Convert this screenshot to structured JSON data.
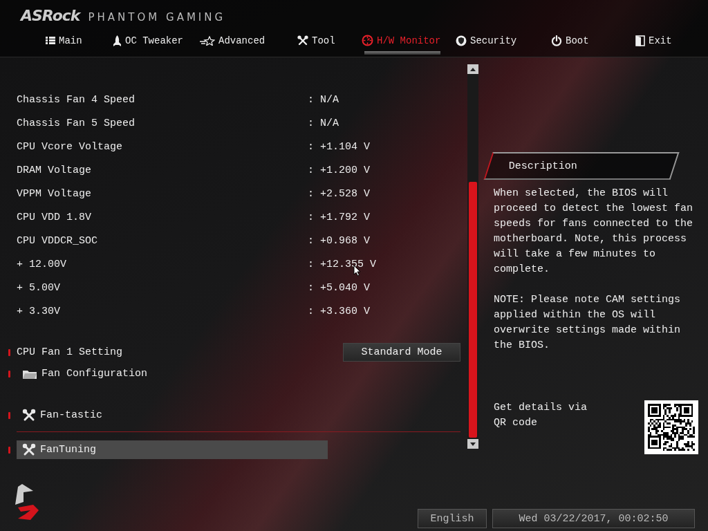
{
  "brand": {
    "logo": "ASRock",
    "subtitle": "PHANTOM GAMING"
  },
  "tabs": [
    {
      "kind": "main",
      "label": "Main",
      "selected": false
    },
    {
      "kind": "oc",
      "label": "OC Tweaker",
      "selected": false
    },
    {
      "kind": "advanced",
      "label": "Advanced",
      "selected": false
    },
    {
      "kind": "tool",
      "label": "Tool",
      "selected": false
    },
    {
      "kind": "monitor",
      "label": "H/W Monitor",
      "selected": true
    },
    {
      "kind": "security",
      "label": "Security",
      "selected": false
    },
    {
      "kind": "boot",
      "label": "Boot",
      "selected": false
    },
    {
      "kind": "exit",
      "label": "Exit",
      "selected": false
    }
  ],
  "readings": [
    {
      "label": "Chassis Fan 4 Speed",
      "value": ": N/A"
    },
    {
      "label": "Chassis Fan 5 Speed",
      "value": ": N/A"
    },
    {
      "label": "CPU Vcore Voltage",
      "value": ": +1.104 V"
    },
    {
      "label": "DRAM Voltage",
      "value": ": +1.200 V"
    },
    {
      "label": "VPPM Voltage",
      "value": ": +2.528 V"
    },
    {
      "label": "CPU VDD 1.8V",
      "value": ": +1.792 V"
    },
    {
      "label": "CPU VDDCR_SOC",
      "value": ": +0.968 V"
    },
    {
      "label": "+ 12.00V",
      "value": ": +12.355 V"
    },
    {
      "label": "+ 5.00V",
      "value": ": +5.040 V"
    },
    {
      "label": "+ 3.30V",
      "value": ": +3.360 V"
    }
  ],
  "menu": [
    {
      "kind": "setting",
      "label": "CPU Fan 1 Setting",
      "value": "Standard Mode",
      "selected": false
    },
    {
      "kind": "folder",
      "label": "Fan Configuration",
      "selected": false
    },
    {
      "kind": "tool",
      "label": "Fan-tastic",
      "selected": false
    },
    {
      "kind": "tool",
      "label": "FanTuning",
      "selected": true
    }
  ],
  "description": {
    "title": "Description",
    "paragraphs": [
      "When selected, the BIOS will proceed to detect the lowest fan speeds for fans connected to the motherboard. Note, this process will take a few minutes to complete.",
      "NOTE: Please note CAM settings applied within the OS will overwrite settings made within the BIOS."
    ],
    "qr_caption": "Get details via QR code"
  },
  "footer": {
    "language": "English",
    "datetime": "Wed 03/22/2017, 00:02:50"
  }
}
